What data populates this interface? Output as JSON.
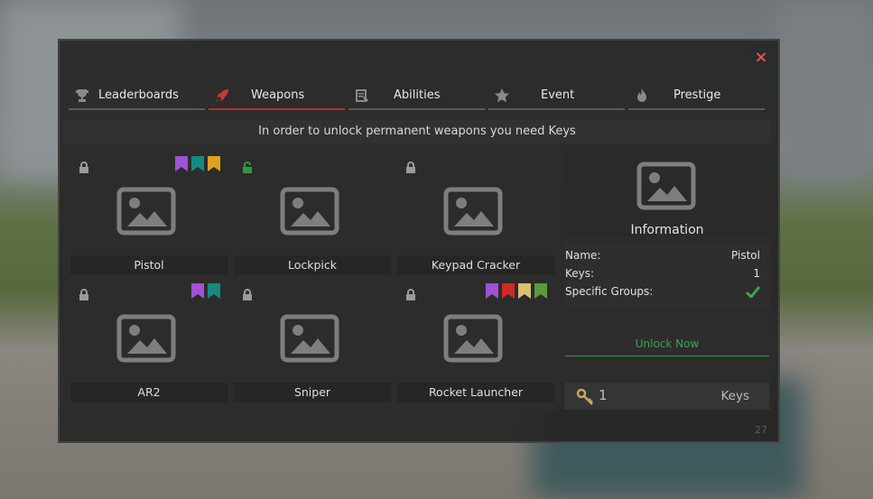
{
  "window": {
    "close_label": "×"
  },
  "tabs": [
    {
      "label": "Leaderboards",
      "icon": "trophy-icon"
    },
    {
      "label": "Weapons",
      "icon": "rocket-icon",
      "active": true
    },
    {
      "label": "Abilities",
      "icon": "abilities-icon"
    },
    {
      "label": "Event",
      "icon": "star-icon"
    },
    {
      "label": "Prestige",
      "icon": "fire-icon"
    }
  ],
  "banner": "In order to unlock permanent weapons you need Keys",
  "weapons": [
    {
      "name": "Pistol",
      "locked": true,
      "ribbons": [
        "#a052d6",
        "#168a80",
        "#e0a020"
      ]
    },
    {
      "name": "Lockpick",
      "locked": false,
      "ribbons": []
    },
    {
      "name": "Keypad Cracker",
      "locked": true,
      "ribbons": []
    },
    {
      "name": "AR2",
      "locked": true,
      "ribbons": [
        "#a052d6",
        "#168a80"
      ]
    },
    {
      "name": "Sniper",
      "locked": true,
      "ribbons": []
    },
    {
      "name": "Rocket Launcher",
      "locked": true,
      "ribbons": [
        "#a052d6",
        "#d02828",
        "#d8c070",
        "#5a9a3a"
      ]
    }
  ],
  "info": {
    "title": "Information",
    "name_label": "Name:",
    "name_value": "Pistol",
    "keys_label": "Keys:",
    "keys_value": "1",
    "groups_label": "Specific Groups:"
  },
  "unlock_label": "Unlock Now",
  "keys_bar": {
    "count": "1",
    "label": "Keys"
  },
  "page_number": "27",
  "colors": {
    "accent": "#b03030",
    "success": "#3aa455",
    "close": "#e25050"
  }
}
